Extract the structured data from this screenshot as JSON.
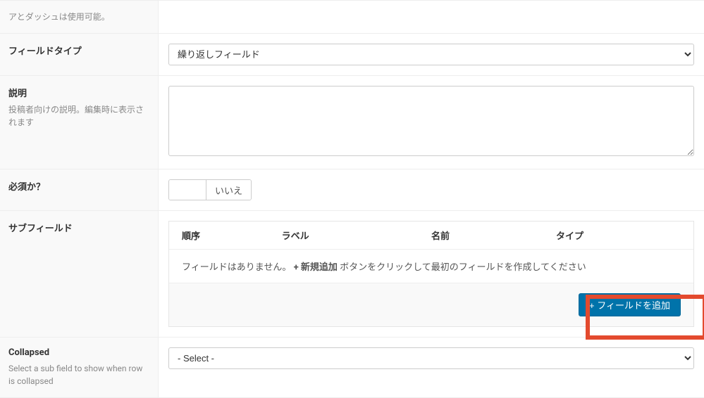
{
  "top_note": "アとダッシュは使用可能。",
  "field_type": {
    "label": "フィールドタイプ",
    "selected": "繰り返しフィールド"
  },
  "description": {
    "label": "説明",
    "hint": "投稿者向けの説明。編集時に表示されます",
    "value": ""
  },
  "required": {
    "label": "必須か？",
    "value": "",
    "toggle_text": "いいえ"
  },
  "subfields": {
    "label": "サブフィールド",
    "columns": {
      "order": "順序",
      "label": "ラベル",
      "name": "名前",
      "type": "タイプ"
    },
    "empty": {
      "pre": "フィールドはありません。",
      "bold": "+ 新規追加",
      "post": "ボタンをクリックして最初のフィールドを作成してください"
    },
    "add_button": "+ フィールドを追加"
  },
  "collapsed": {
    "label": "Collapsed",
    "hint": "Select a sub field to show when row is collapsed",
    "selected": "- Select -"
  }
}
